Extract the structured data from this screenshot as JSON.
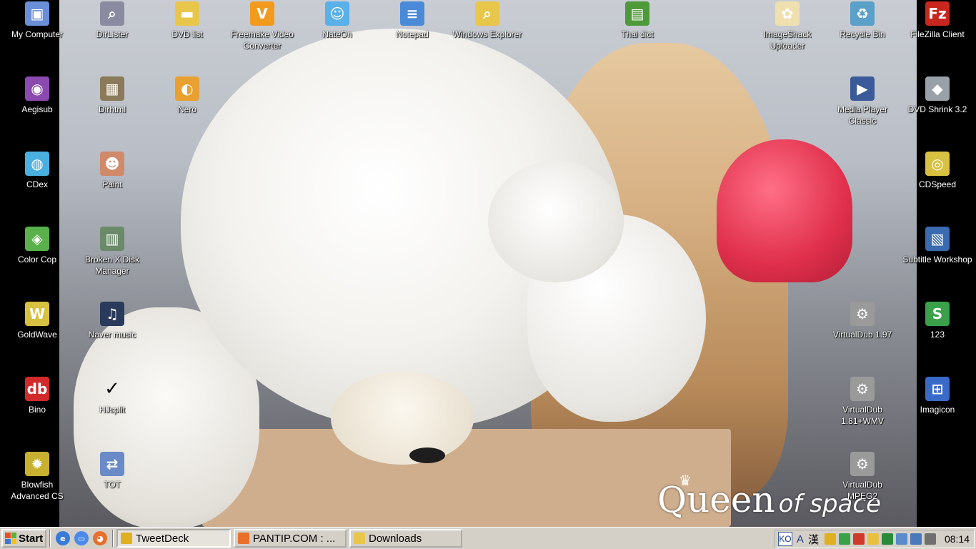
{
  "desktop": {
    "icons": [
      {
        "label": "My Computer",
        "icon": "computer-icon",
        "color": "#6a8fd8"
      },
      {
        "label": "DirLister",
        "icon": "magnifier-icon",
        "color": "#8a8aa0"
      },
      {
        "label": "DVD list",
        "icon": "folder-icon",
        "color": "#e8c64a"
      },
      {
        "label": "Freemake Video Converter",
        "icon": "freemake-icon",
        "color": "#f29a1e"
      },
      {
        "label": "NateOn",
        "icon": "nateon-icon",
        "color": "#5ab0e8"
      },
      {
        "label": "Notepad",
        "icon": "notepad-icon",
        "color": "#4a8ad8"
      },
      {
        "label": "Windows Explorer",
        "icon": "explorer-icon",
        "color": "#e8c64a"
      },
      {
        "label": "Thai dict",
        "icon": "book-icon",
        "color": "#4e9a3a"
      },
      {
        "label": "ImageShack Uploader",
        "icon": "imageshack-icon",
        "color": "#f0e0b0"
      },
      {
        "label": "Recycle Bin",
        "icon": "recycle-bin-icon",
        "color": "#5aa0c8"
      },
      {
        "label": "FileZilla Client",
        "icon": "filezilla-icon",
        "color": "#c8261e"
      },
      {
        "label": "Aegisub",
        "icon": "aegisub-icon",
        "color": "#8a4ab0"
      },
      {
        "label": "Dirhtml",
        "icon": "dirhtml-icon",
        "color": "#8a7a5a"
      },
      {
        "label": "Nero",
        "icon": "nero-icon",
        "color": "#e8a030"
      },
      {
        "label": "Media Player Classic",
        "icon": "media-player-icon",
        "color": "#3a5a9a"
      },
      {
        "label": "DVD Shrink 3.2",
        "icon": "dvd-shrink-icon",
        "color": "#9aa0a8"
      },
      {
        "label": "CDex",
        "icon": "cdex-icon",
        "color": "#4ab0e0"
      },
      {
        "label": "Paint",
        "icon": "paint-icon",
        "color": "#d08a6a"
      },
      {
        "label": "CDSpeed",
        "icon": "cdspeed-icon",
        "color": "#d8c040"
      },
      {
        "label": "Color Cop",
        "icon": "color-cop-icon",
        "color": "#5ab04a"
      },
      {
        "label": "Broken X Disk Manager",
        "icon": "disk-manager-icon",
        "color": "#6a8a6a"
      },
      {
        "label": "Subtitle Workshop",
        "icon": "subtitle-workshop-icon",
        "color": "#3a6ab0"
      },
      {
        "label": "GoldWave",
        "icon": "goldwave-icon",
        "color": "#d8c040"
      },
      {
        "label": "Naver music",
        "icon": "music-icon",
        "color": "#2a3a5a"
      },
      {
        "label": "VirtualDub 1.97",
        "icon": "virtualdub-icon",
        "color": "#9a9a9a"
      },
      {
        "label": "123",
        "icon": "app-123-icon",
        "color": "#3aa04a"
      },
      {
        "label": "Bino",
        "icon": "bino-icon",
        "color": "#d02a2a"
      },
      {
        "label": "HJsplit",
        "icon": "checkmark-icon",
        "color": "#000000"
      },
      {
        "label": "VirtualDub 1.81+WMV",
        "icon": "virtualdub-icon",
        "color": "#9a9a9a"
      },
      {
        "label": "Imagicon",
        "icon": "imagicon-icon",
        "color": "#3a6ac8"
      },
      {
        "label": "Blowfish Advanced CS",
        "icon": "blowfish-icon",
        "color": "#c8b030"
      },
      {
        "label": "TOT",
        "icon": "tot-icon",
        "color": "#6a8ac8"
      },
      {
        "label": "VirtualDub MPEG2",
        "icon": "virtualdub-icon",
        "color": "#9a9a9a"
      }
    ],
    "wallpaper_text": {
      "big": "Queen",
      "small": "of space"
    }
  },
  "taskbar": {
    "start_label": "Start",
    "quick_launch": [
      {
        "name": "internet-explorer-icon",
        "color": "#3a7ad8"
      },
      {
        "name": "show-desktop-icon",
        "color": "#4a8ae8"
      },
      {
        "name": "firefox-icon",
        "color": "#e8702a"
      }
    ],
    "tasks": [
      {
        "label": "TweetDeck",
        "icon": "tweetdeck-icon",
        "color": "#e0b020",
        "active": true
      },
      {
        "label": "PANTIP.COM : ...",
        "icon": "firefox-icon",
        "color": "#e8702a",
        "active": false
      },
      {
        "label": "Downloads",
        "icon": "folder-icon",
        "color": "#e8c64a",
        "active": false
      }
    ],
    "tray": {
      "language": "KO",
      "ime_a": "A",
      "ime_han": "漢",
      "clock": "08:14",
      "icons": [
        {
          "name": "tweetdeck-tray-icon",
          "color": "#e0b020"
        },
        {
          "name": "hangul-tray-icon",
          "color": "#3aa04a"
        },
        {
          "name": "antivirus-tray-icon",
          "color": "#d03a2a"
        },
        {
          "name": "security-shield-icon",
          "color": "#e8c040"
        },
        {
          "name": "monitor-tray-icon",
          "color": "#2a8a3a"
        },
        {
          "name": "network-tray-icon",
          "color": "#5a8ac8"
        },
        {
          "name": "network-connections-icon",
          "color": "#4a7ab8"
        },
        {
          "name": "speaker-icon",
          "color": "#707070"
        }
      ]
    }
  }
}
